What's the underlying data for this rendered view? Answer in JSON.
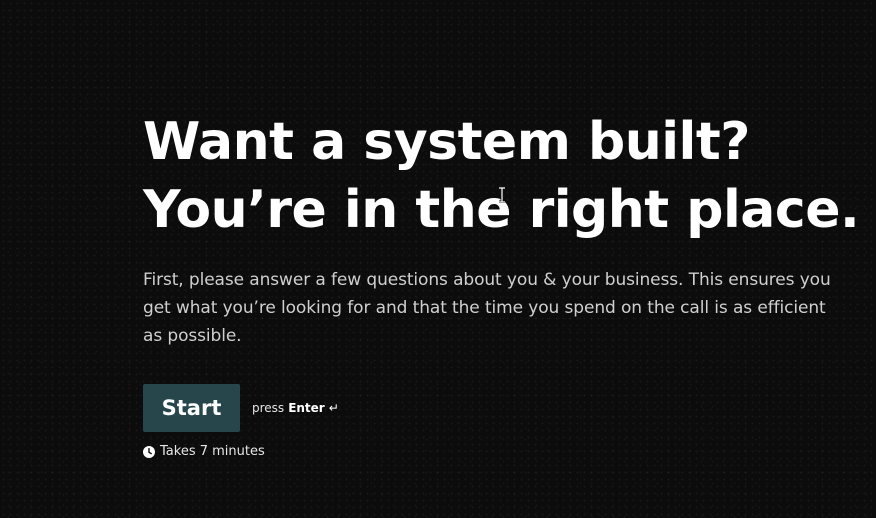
{
  "headline": {
    "line1": "Want a system built?",
    "line2": "You’re in the right place."
  },
  "description": "First, please answer a few questions about you & your business. This ensures you get what you’re looking for and that the time you spend on the call is as efficient as possible.",
  "start_button": {
    "label": "Start"
  },
  "hint": {
    "prefix": "press",
    "key": "Enter",
    "icon": "↵"
  },
  "duration": {
    "text": "Takes 7 minutes",
    "icon": "clock-icon"
  },
  "colors": {
    "background": "#0c0c0c",
    "button": "#27464c",
    "text": "#ffffff",
    "description": "#cfcfcf"
  }
}
